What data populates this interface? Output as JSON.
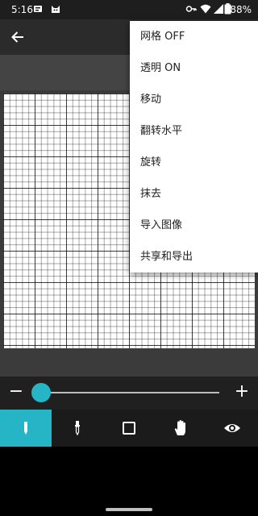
{
  "status_bar": {
    "time": "5:16",
    "battery": "88%",
    "icons": [
      "notification-icon",
      "cat-icon",
      "key-icon",
      "wifi-icon",
      "signal-icon",
      "battery-icon"
    ]
  },
  "app_bar": {
    "back_icon": "arrow-left-icon"
  },
  "menu": {
    "items": [
      {
        "label": "网格 OFF"
      },
      {
        "label": "透明 ON"
      },
      {
        "label": "移动"
      },
      {
        "label": "翻转水平"
      },
      {
        "label": "旋转"
      },
      {
        "label": "抹去"
      },
      {
        "label": "导入图像"
      },
      {
        "label": "共享和导出"
      }
    ]
  },
  "brush_size": {
    "minus": "−",
    "plus": "+",
    "value_fraction": 0.02
  },
  "toolbar": {
    "tools": [
      {
        "name": "pencil-icon",
        "active": true
      },
      {
        "name": "eyedropper-icon",
        "active": false
      },
      {
        "name": "square-icon",
        "active": false
      },
      {
        "name": "hand-icon",
        "active": false
      },
      {
        "name": "eye-icon",
        "active": false
      }
    ]
  },
  "colors": {
    "accent": "#26b5c6",
    "app_bar": "#2b2b2b",
    "menu_bg": "#ffffff"
  }
}
